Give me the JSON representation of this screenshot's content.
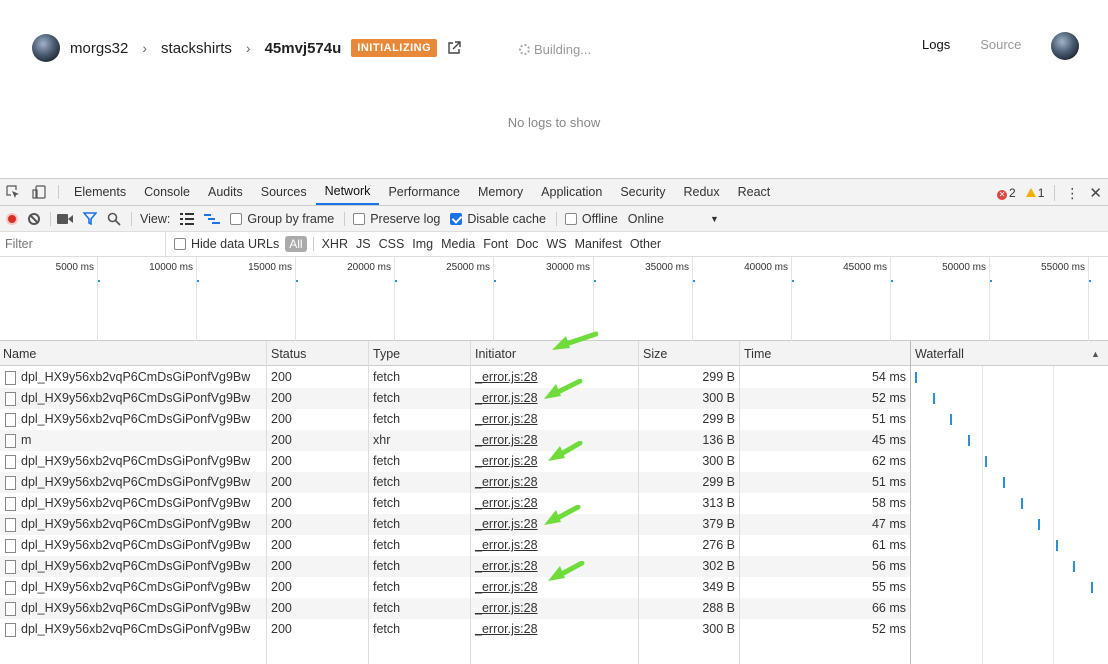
{
  "app": {
    "breadcrumb": {
      "user": "morgs32",
      "project": "stackshirts",
      "deployment": "45mvj574u",
      "sep": "›"
    },
    "status_badge": "INITIALIZING",
    "building_text": "Building...",
    "tabs": {
      "logs": "Logs",
      "source": "Source"
    },
    "empty_message": "No logs to show"
  },
  "devtools": {
    "tabs": [
      "Elements",
      "Console",
      "Audits",
      "Sources",
      "Network",
      "Performance",
      "Memory",
      "Application",
      "Security",
      "Redux",
      "React"
    ],
    "active_tab": "Network",
    "error_count": "2",
    "warning_count": "1",
    "toolbar": {
      "view_label": "View:",
      "group_by_frame": "Group by frame",
      "preserve_log": "Preserve log",
      "disable_cache": "Disable cache",
      "offline": "Offline",
      "throttle": "Online"
    },
    "filter": {
      "placeholder": "Filter",
      "hide_data_urls": "Hide data URLs",
      "all": "All",
      "types": [
        "XHR",
        "JS",
        "CSS",
        "Img",
        "Media",
        "Font",
        "Doc",
        "WS",
        "Manifest",
        "Other"
      ]
    },
    "overview_ticks": [
      "5000 ms",
      "10000 ms",
      "15000 ms",
      "20000 ms",
      "25000 ms",
      "30000 ms",
      "35000 ms",
      "40000 ms",
      "45000 ms",
      "50000 ms",
      "55000 ms"
    ],
    "columns": {
      "name": "Name",
      "status": "Status",
      "type": "Type",
      "initiator": "Initiator",
      "size": "Size",
      "time": "Time",
      "waterfall": "Waterfall"
    },
    "rows": [
      {
        "name": "dpl_HX9y56xb2vqP6CmDsGiPonfVg9Bw",
        "status": "200",
        "type": "fetch",
        "initiator": "_error.js:28",
        "size": "299 B",
        "time": "54 ms"
      },
      {
        "name": "dpl_HX9y56xb2vqP6CmDsGiPonfVg9Bw",
        "status": "200",
        "type": "fetch",
        "initiator": "_error.js:28",
        "size": "300 B",
        "time": "52 ms"
      },
      {
        "name": "dpl_HX9y56xb2vqP6CmDsGiPonfVg9Bw",
        "status": "200",
        "type": "fetch",
        "initiator": "_error.js:28",
        "size": "299 B",
        "time": "51 ms"
      },
      {
        "name": "m",
        "status": "200",
        "type": "xhr",
        "initiator": "_error.js:28",
        "size": "136 B",
        "time": "45 ms"
      },
      {
        "name": "dpl_HX9y56xb2vqP6CmDsGiPonfVg9Bw",
        "status": "200",
        "type": "fetch",
        "initiator": "_error.js:28",
        "size": "300 B",
        "time": "62 ms"
      },
      {
        "name": "dpl_HX9y56xb2vqP6CmDsGiPonfVg9Bw",
        "status": "200",
        "type": "fetch",
        "initiator": "_error.js:28",
        "size": "299 B",
        "time": "51 ms"
      },
      {
        "name": "dpl_HX9y56xb2vqP6CmDsGiPonfVg9Bw",
        "status": "200",
        "type": "fetch",
        "initiator": "_error.js:28",
        "size": "313 B",
        "time": "58 ms"
      },
      {
        "name": "dpl_HX9y56xb2vqP6CmDsGiPonfVg9Bw",
        "status": "200",
        "type": "fetch",
        "initiator": "_error.js:28",
        "size": "379 B",
        "time": "47 ms"
      },
      {
        "name": "dpl_HX9y56xb2vqP6CmDsGiPonfVg9Bw",
        "status": "200",
        "type": "fetch",
        "initiator": "_error.js:28",
        "size": "276 B",
        "time": "61 ms"
      },
      {
        "name": "dpl_HX9y56xb2vqP6CmDsGiPonfVg9Bw",
        "status": "200",
        "type": "fetch",
        "initiator": "_error.js:28",
        "size": "302 B",
        "time": "56 ms"
      },
      {
        "name": "dpl_HX9y56xb2vqP6CmDsGiPonfVg9Bw",
        "status": "200",
        "type": "fetch",
        "initiator": "_error.js:28",
        "size": "349 B",
        "time": "55 ms"
      },
      {
        "name": "dpl_HX9y56xb2vqP6CmDsGiPonfVg9Bw",
        "status": "200",
        "type": "fetch",
        "initiator": "_error.js:28",
        "size": "288 B",
        "time": "66 ms"
      },
      {
        "name": "dpl_HX9y56xb2vqP6CmDsGiPonfVg9Bw",
        "status": "200",
        "type": "fetch",
        "initiator": "_error.js:28",
        "size": "300 B",
        "time": "52 ms"
      }
    ]
  },
  "colors": {
    "badge": "#e8893a",
    "accent": "#1a73e8",
    "waterfall": "#2d8fd6",
    "annotation_arrow": "#6fdc3c"
  }
}
